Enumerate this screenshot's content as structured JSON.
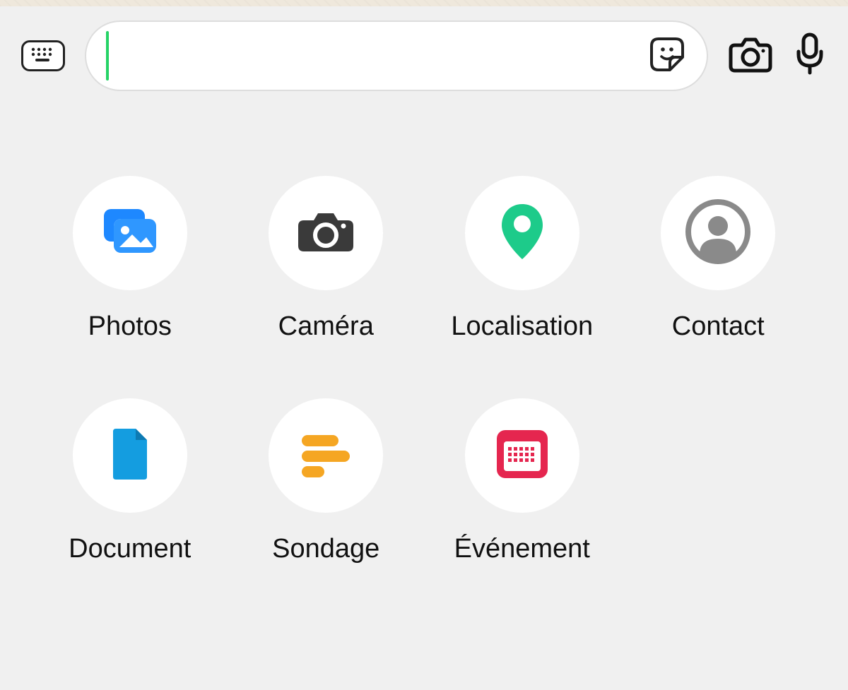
{
  "toolbar": {
    "message_value": "",
    "message_placeholder": ""
  },
  "attachments": [
    {
      "label": "Photos"
    },
    {
      "label": "Caméra"
    },
    {
      "label": "Localisation"
    },
    {
      "label": "Contact"
    },
    {
      "label": "Document"
    },
    {
      "label": "Sondage"
    },
    {
      "label": "Événement"
    }
  ]
}
